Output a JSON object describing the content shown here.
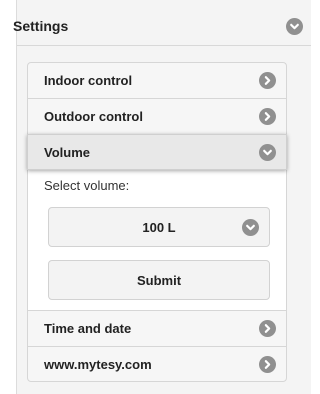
{
  "panel": {
    "title": "Settings",
    "toggle_icon": "chevron-down-icon"
  },
  "menu": {
    "items": [
      {
        "label": "Indoor control",
        "icon": "chevron-right-icon"
      },
      {
        "label": "Outdoor control",
        "icon": "chevron-right-icon"
      },
      {
        "label": "Volume",
        "icon": "chevron-down-icon"
      },
      {
        "label": "Time and date",
        "icon": "chevron-right-icon"
      },
      {
        "label": "www.mytesy.com",
        "icon": "chevron-right-icon"
      }
    ]
  },
  "volume": {
    "select_label": "Select volume:",
    "selected_value": "100 L",
    "submit_label": "Submit"
  },
  "colors": {
    "panel_background": "#f4f4f4",
    "icon_circle": "#909090",
    "active_item": "#e8e8e8"
  }
}
